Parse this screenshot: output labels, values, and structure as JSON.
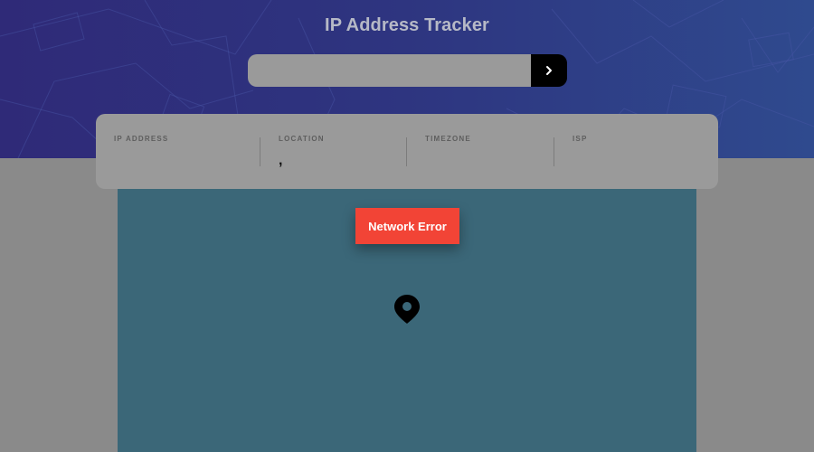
{
  "header": {
    "title": "IP Address Tracker"
  },
  "search": {
    "value": "",
    "placeholder": "",
    "submit_icon": "chevron-right-icon"
  },
  "info": {
    "ip_label": "IP ADDRESS",
    "ip_value": "",
    "location_label": "LOCATION",
    "location_value": ",",
    "timezone_label": "TIMEZONE",
    "timezone_value": "",
    "isp_label": "ISP",
    "isp_value": ""
  },
  "map": {
    "marker_icon": "location-pin-icon"
  },
  "toast": {
    "message": "Network Error"
  },
  "colors": {
    "header_start": "#2f2a78",
    "header_end": "#2f4a8e",
    "map": "#3b6778",
    "toast": "#f24436",
    "button": "#000000"
  }
}
